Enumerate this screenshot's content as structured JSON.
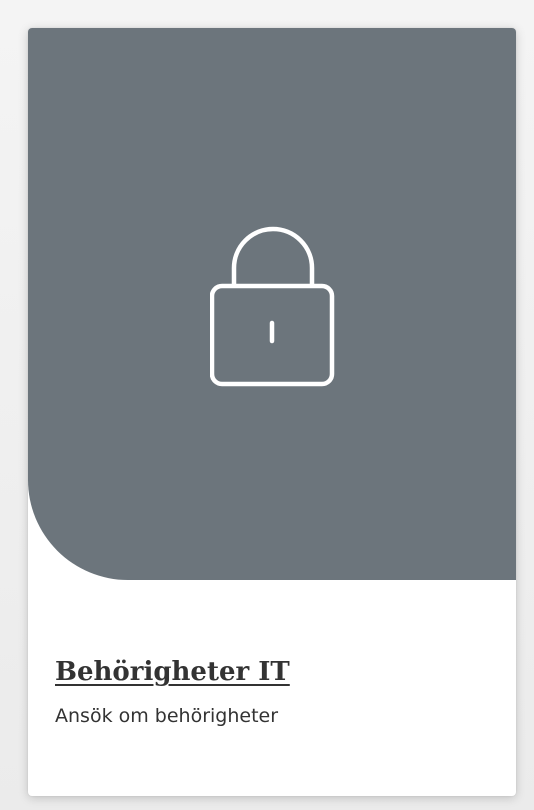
{
  "card": {
    "title": "Behörigheter IT",
    "subtitle": "Ansök om behörigheter",
    "icon": "lock-icon",
    "hero_color": "#6c757c",
    "icon_color": "#ffffff"
  }
}
